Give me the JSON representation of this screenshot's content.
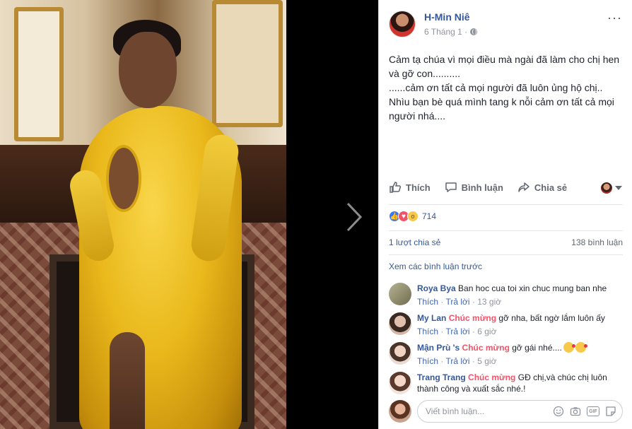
{
  "post": {
    "author": "H-Min Niê",
    "date": "6 Tháng 1 ·",
    "text": "Cảm tạ chúa vì mọi điều mà ngài đã làm cho chị hen và gỡ con..........\n......cảm ơn tất cả mọi người đã luôn ủng hộ chị..\nNhìu bạn bè quá mình tang k nỗi cảm ơn tất cả mọi người nhá...."
  },
  "actions": {
    "like": "Thích",
    "comment": "Bình luận",
    "share": "Chia sẻ"
  },
  "stats": {
    "reactions_count": "714",
    "shares": "1 lượt chia sẻ",
    "comments": "138 bình luận",
    "view_previous": "Xem các bình luận trước"
  },
  "comments": [
    {
      "name": "Roya Bya",
      "tag": "",
      "text": "Ban hoc cua toi xin chuc mung ban nhe",
      "text2": "",
      "like": "Thích",
      "reply": "Trả lời",
      "time": "13 giờ",
      "avatar_color": "#8a8f6a"
    },
    {
      "name": "My Lan",
      "tag": "Chúc mừng",
      "text": "gỡ nha, bất ngờ lắm luôn ấy",
      "text2": "",
      "like": "Thích",
      "reply": "Trả lời",
      "time": "6 giờ",
      "avatar_color": "#c7a08a"
    },
    {
      "name": "Mận Prù 's",
      "tag": "Chúc mừng",
      "text": "gỡ gái nhé....",
      "text2": "",
      "like": "Thích",
      "reply": "Trả lời",
      "time": "5 giờ",
      "avatar_color": "#d8b9a8"
    },
    {
      "name": "Trang Trang",
      "tag": "Chúc mừng",
      "text": "GĐ chị,và chúc chị luôn",
      "text2": "thành công và xuất sắc nhé.!",
      "like": "",
      "reply": "",
      "time": "",
      "avatar_color": "#e2bca8"
    }
  ],
  "composer": {
    "placeholder": "Viết bình luận..."
  },
  "icons": [
    "globe-icon",
    "more-icon",
    "like-icon",
    "comment-icon",
    "share-icon",
    "chevron-right-icon",
    "emoji-icon",
    "camera-icon",
    "gif-icon",
    "sticker-icon"
  ],
  "colors": {
    "link": "#365899",
    "tag": "#f35369",
    "text": "#1d2129",
    "muted": "#90949c"
  }
}
